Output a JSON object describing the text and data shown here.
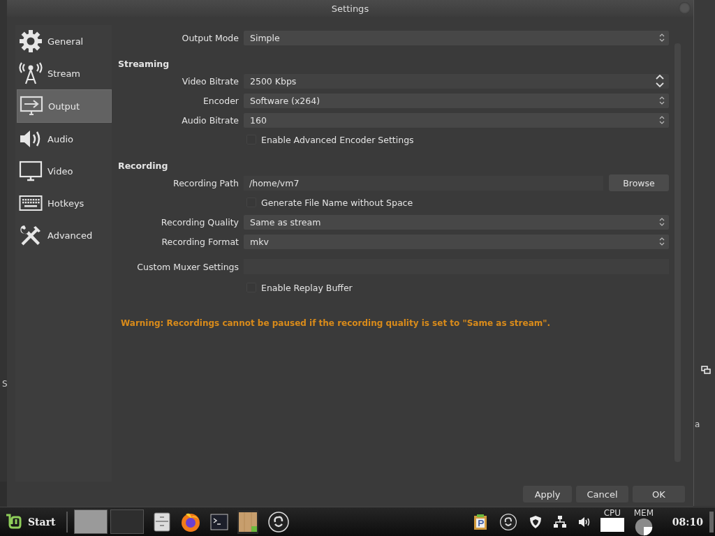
{
  "window": {
    "title": "Settings"
  },
  "background_window": {
    "left_letters": [
      "S"
    ],
    "right_letters": [
      "a"
    ]
  },
  "sidebar": {
    "items": [
      {
        "label": "General",
        "selected": false
      },
      {
        "label": "Stream",
        "selected": false
      },
      {
        "label": "Output",
        "selected": true
      },
      {
        "label": "Audio",
        "selected": false
      },
      {
        "label": "Video",
        "selected": false
      },
      {
        "label": "Hotkeys",
        "selected": false
      },
      {
        "label": "Advanced",
        "selected": false
      }
    ]
  },
  "output_mode": {
    "label": "Output Mode",
    "value": "Simple"
  },
  "sections": [
    {
      "title": "Streaming",
      "rows": [
        {
          "kind": "spin",
          "label": "Video Bitrate",
          "value": "2500 Kbps"
        },
        {
          "kind": "select",
          "label": "Encoder",
          "value": "Software (x264)"
        },
        {
          "kind": "select",
          "label": "Audio Bitrate",
          "value": "160"
        },
        {
          "kind": "checkbox",
          "label": "Enable Advanced Encoder Settings",
          "checked": false
        }
      ]
    },
    {
      "title": "Recording",
      "rows": [
        {
          "kind": "path",
          "label": "Recording Path",
          "value": "/home/vm7",
          "button": "Browse"
        },
        {
          "kind": "checkbox",
          "label": "Generate File Name without Space",
          "checked": false
        },
        {
          "kind": "select",
          "label": "Recording Quality",
          "value": "Same as stream"
        },
        {
          "kind": "select",
          "label": "Recording Format",
          "value": "mkv"
        },
        {
          "kind": "text",
          "label": "Custom Muxer Settings"
        },
        {
          "kind": "checkbox",
          "label": "Enable Replay Buffer",
          "checked": false
        }
      ]
    }
  ],
  "warning": "Warning: Recordings cannot be paused if the recording quality is set to \"Same as stream\".",
  "buttons": [
    "Apply",
    "Cancel",
    "OK"
  ],
  "taskbar": {
    "start": "Start",
    "cpu": "CPU",
    "mem": "MEM",
    "clock": "08:10"
  }
}
